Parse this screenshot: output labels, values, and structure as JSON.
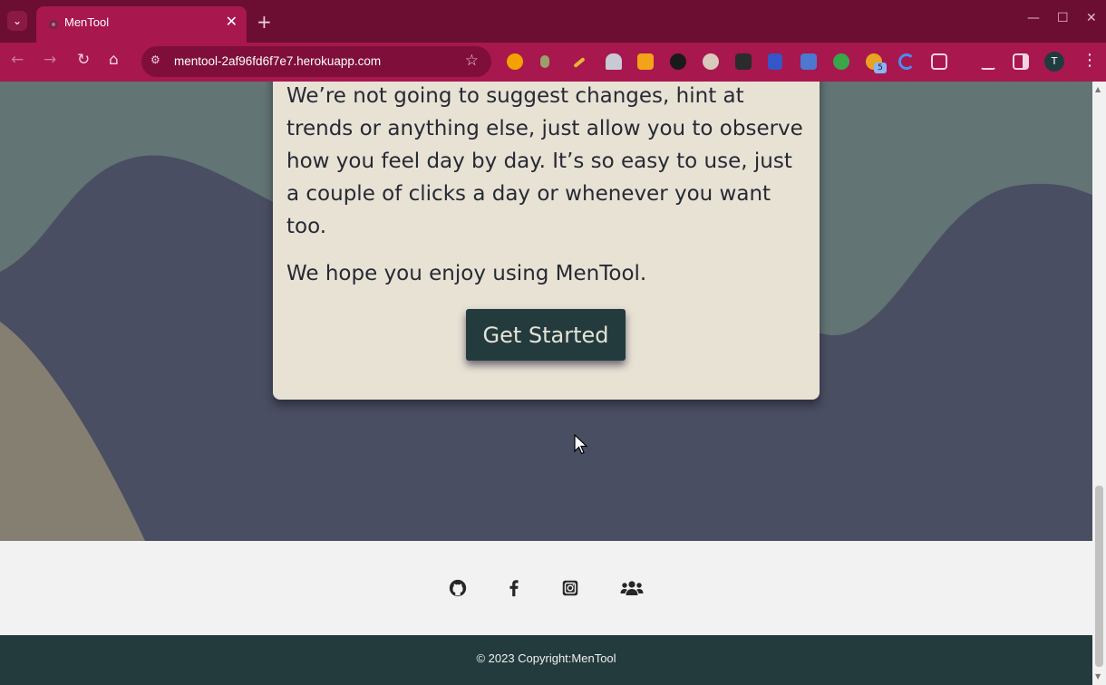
{
  "browser": {
    "tab_title": "MenTool",
    "tab_close": "✕",
    "new_tab": "+",
    "url": "mentool-2af96fd6f7e7.herokuapp.com",
    "extension_badge": "5",
    "profile_initial": "T",
    "tab_search": "⌄",
    "star": "☆",
    "site_info": "⚙",
    "back": "←",
    "forward": "→",
    "reload": "↻",
    "home": "⌂",
    "minimize": "—",
    "maximize": "☐",
    "close": "✕",
    "menu": "⋮"
  },
  "card": {
    "paragraph_1": "We’re not going to suggest changes, hint at trends or anything else, just allow you to observe how you feel day by day. It’s so easy to use, just a couple of clicks a day or whenever you want too.",
    "paragraph_2": "We hope you enjoy using MenTool.",
    "cta_label": "Get Started"
  },
  "social": {
    "icons": [
      "github-icon",
      "facebook-icon",
      "instagram-icon",
      "users-icon"
    ]
  },
  "footer": {
    "copyright": "© 2023 Copyright:MenTool"
  },
  "colors": {
    "chrome_tabbar": "#6b0e32",
    "chrome_toolbar": "#a8174e",
    "background": "#4a4e62",
    "wave_teal": "#627473",
    "wave_khaki": "#857f72",
    "card": "#e8e2d5",
    "accent_dark": "#233b3d"
  }
}
